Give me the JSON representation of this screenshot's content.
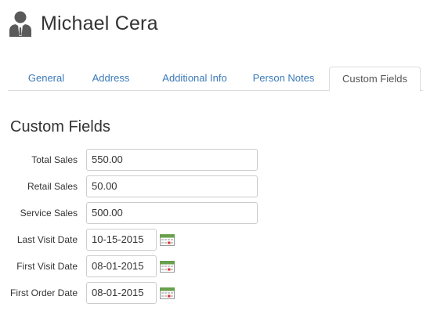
{
  "person": {
    "name": "Michael Cera",
    "icon": "person-silhouette-icon"
  },
  "tabs": [
    {
      "label": "General",
      "active": false
    },
    {
      "label": "Address",
      "active": false
    },
    {
      "label": "Additional Info",
      "active": false
    },
    {
      "label": "Person Notes",
      "active": false
    },
    {
      "label": "Custom Fields",
      "active": true
    }
  ],
  "section": {
    "title": "Custom Fields"
  },
  "fields": [
    {
      "label": "Total Sales",
      "value": "550.00"
    },
    {
      "label": "Retail Sales",
      "value": "50.00"
    },
    {
      "label": "Service Sales",
      "value": "500.00"
    },
    {
      "label": "Last Visit Date",
      "value": "10-15-2015",
      "icon": "calendar-icon"
    },
    {
      "label": "First Visit Date",
      "value": "08-01-2015",
      "icon": "calendar-icon"
    },
    {
      "label": "First Order Date",
      "value": "08-01-2015",
      "icon": "calendar-icon"
    }
  ],
  "colors": {
    "link": "#3a7ab7",
    "border": "#cccccc",
    "calendar_accent": "#6aa04c"
  }
}
